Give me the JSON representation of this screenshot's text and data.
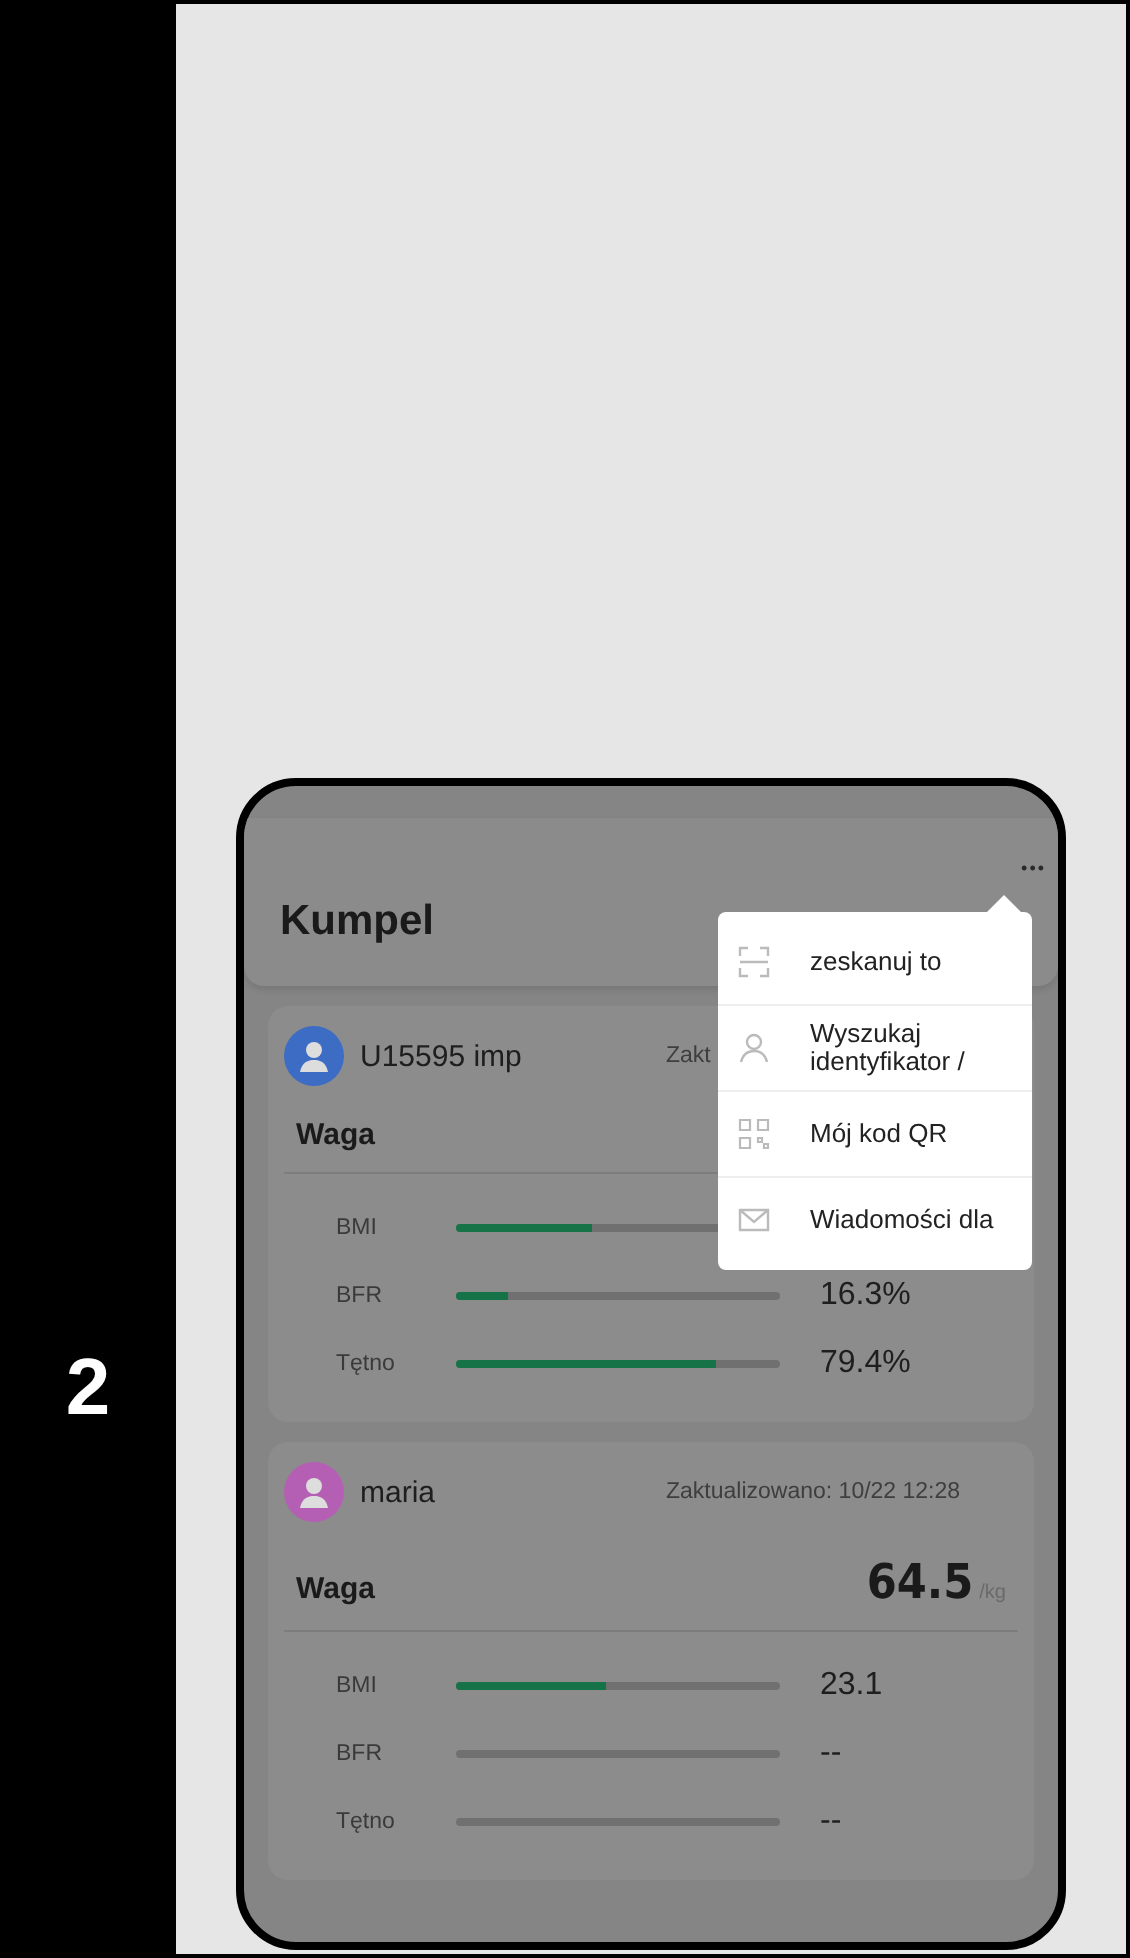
{
  "step_number": "2",
  "app": {
    "title": "Kumpel",
    "more_button": "•••",
    "menu": [
      {
        "kind": "scan",
        "label": "zeskanuj to"
      },
      {
        "kind": "person",
        "label": "Wyszukaj identyfikator /"
      },
      {
        "kind": "qr",
        "label": "Mój kod QR"
      },
      {
        "kind": "mail",
        "label": "Wiadomości dla"
      }
    ],
    "friends": [
      {
        "name": "U15595 imp",
        "color": "#3d6cc4",
        "updated": "Zakt",
        "metric_title": "Waga",
        "metrics": [
          {
            "label": "BMI",
            "level": 0.42
          },
          {
            "label": "BFR",
            "level": 0.16,
            "reading": "16.3%"
          },
          {
            "label": "Tętno",
            "level": 0.8,
            "reading": "79.4%"
          }
        ]
      },
      {
        "name": "maria",
        "color": "#b45fb4",
        "updated": "Zaktualizowano: 10/22 12:28",
        "metric_title": "Waga",
        "weight": "64.5",
        "unit": "/kg",
        "metrics": [
          {
            "label": "BMI",
            "level": 0.46,
            "reading": "23.1"
          },
          {
            "label": "BFR",
            "level": 0,
            "reading": "--"
          },
          {
            "label": "Tętno",
            "level": 0,
            "reading": "--"
          }
        ]
      }
    ]
  }
}
